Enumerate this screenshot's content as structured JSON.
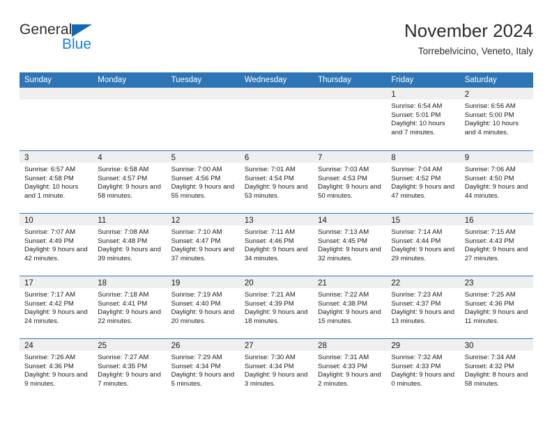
{
  "brand": {
    "word1": "General",
    "word2": "Blue",
    "triangle_color": "#1268b3",
    "blue_color": "#1c7fd1"
  },
  "header": {
    "title": "November 2024",
    "subtitle": "Torrebelvicino, Veneto, Italy"
  },
  "theme": {
    "header_blue": "#2e75b6",
    "day_band_gray": "#efefef",
    "text": "#1a1a1a"
  },
  "weekdays": [
    "Sunday",
    "Monday",
    "Tuesday",
    "Wednesday",
    "Thursday",
    "Friday",
    "Saturday"
  ],
  "weeks": [
    [
      {
        "day": ""
      },
      {
        "day": ""
      },
      {
        "day": ""
      },
      {
        "day": ""
      },
      {
        "day": ""
      },
      {
        "day": "1",
        "sunrise": "Sunrise: 6:54 AM",
        "sunset": "Sunset: 5:01 PM",
        "daylight": "Daylight: 10 hours and 7 minutes."
      },
      {
        "day": "2",
        "sunrise": "Sunrise: 6:56 AM",
        "sunset": "Sunset: 5:00 PM",
        "daylight": "Daylight: 10 hours and 4 minutes."
      }
    ],
    [
      {
        "day": "3",
        "sunrise": "Sunrise: 6:57 AM",
        "sunset": "Sunset: 4:58 PM",
        "daylight": "Daylight: 10 hours and 1 minute."
      },
      {
        "day": "4",
        "sunrise": "Sunrise: 6:58 AM",
        "sunset": "Sunset: 4:57 PM",
        "daylight": "Daylight: 9 hours and 58 minutes."
      },
      {
        "day": "5",
        "sunrise": "Sunrise: 7:00 AM",
        "sunset": "Sunset: 4:56 PM",
        "daylight": "Daylight: 9 hours and 55 minutes."
      },
      {
        "day": "6",
        "sunrise": "Sunrise: 7:01 AM",
        "sunset": "Sunset: 4:54 PM",
        "daylight": "Daylight: 9 hours and 53 minutes."
      },
      {
        "day": "7",
        "sunrise": "Sunrise: 7:03 AM",
        "sunset": "Sunset: 4:53 PM",
        "daylight": "Daylight: 9 hours and 50 minutes."
      },
      {
        "day": "8",
        "sunrise": "Sunrise: 7:04 AM",
        "sunset": "Sunset: 4:52 PM",
        "daylight": "Daylight: 9 hours and 47 minutes."
      },
      {
        "day": "9",
        "sunrise": "Sunrise: 7:06 AM",
        "sunset": "Sunset: 4:50 PM",
        "daylight": "Daylight: 9 hours and 44 minutes."
      }
    ],
    [
      {
        "day": "10",
        "sunrise": "Sunrise: 7:07 AM",
        "sunset": "Sunset: 4:49 PM",
        "daylight": "Daylight: 9 hours and 42 minutes."
      },
      {
        "day": "11",
        "sunrise": "Sunrise: 7:08 AM",
        "sunset": "Sunset: 4:48 PM",
        "daylight": "Daylight: 9 hours and 39 minutes."
      },
      {
        "day": "12",
        "sunrise": "Sunrise: 7:10 AM",
        "sunset": "Sunset: 4:47 PM",
        "daylight": "Daylight: 9 hours and 37 minutes."
      },
      {
        "day": "13",
        "sunrise": "Sunrise: 7:11 AM",
        "sunset": "Sunset: 4:46 PM",
        "daylight": "Daylight: 9 hours and 34 minutes."
      },
      {
        "day": "14",
        "sunrise": "Sunrise: 7:13 AM",
        "sunset": "Sunset: 4:45 PM",
        "daylight": "Daylight: 9 hours and 32 minutes."
      },
      {
        "day": "15",
        "sunrise": "Sunrise: 7:14 AM",
        "sunset": "Sunset: 4:44 PM",
        "daylight": "Daylight: 9 hours and 29 minutes."
      },
      {
        "day": "16",
        "sunrise": "Sunrise: 7:15 AM",
        "sunset": "Sunset: 4:43 PM",
        "daylight": "Daylight: 9 hours and 27 minutes."
      }
    ],
    [
      {
        "day": "17",
        "sunrise": "Sunrise: 7:17 AM",
        "sunset": "Sunset: 4:42 PM",
        "daylight": "Daylight: 9 hours and 24 minutes."
      },
      {
        "day": "18",
        "sunrise": "Sunrise: 7:18 AM",
        "sunset": "Sunset: 4:41 PM",
        "daylight": "Daylight: 9 hours and 22 minutes."
      },
      {
        "day": "19",
        "sunrise": "Sunrise: 7:19 AM",
        "sunset": "Sunset: 4:40 PM",
        "daylight": "Daylight: 9 hours and 20 minutes."
      },
      {
        "day": "20",
        "sunrise": "Sunrise: 7:21 AM",
        "sunset": "Sunset: 4:39 PM",
        "daylight": "Daylight: 9 hours and 18 minutes."
      },
      {
        "day": "21",
        "sunrise": "Sunrise: 7:22 AM",
        "sunset": "Sunset: 4:38 PM",
        "daylight": "Daylight: 9 hours and 15 minutes."
      },
      {
        "day": "22",
        "sunrise": "Sunrise: 7:23 AM",
        "sunset": "Sunset: 4:37 PM",
        "daylight": "Daylight: 9 hours and 13 minutes."
      },
      {
        "day": "23",
        "sunrise": "Sunrise: 7:25 AM",
        "sunset": "Sunset: 4:36 PM",
        "daylight": "Daylight: 9 hours and 11 minutes."
      }
    ],
    [
      {
        "day": "24",
        "sunrise": "Sunrise: 7:26 AM",
        "sunset": "Sunset: 4:36 PM",
        "daylight": "Daylight: 9 hours and 9 minutes."
      },
      {
        "day": "25",
        "sunrise": "Sunrise: 7:27 AM",
        "sunset": "Sunset: 4:35 PM",
        "daylight": "Daylight: 9 hours and 7 minutes."
      },
      {
        "day": "26",
        "sunrise": "Sunrise: 7:29 AM",
        "sunset": "Sunset: 4:34 PM",
        "daylight": "Daylight: 9 hours and 5 minutes."
      },
      {
        "day": "27",
        "sunrise": "Sunrise: 7:30 AM",
        "sunset": "Sunset: 4:34 PM",
        "daylight": "Daylight: 9 hours and 3 minutes."
      },
      {
        "day": "28",
        "sunrise": "Sunrise: 7:31 AM",
        "sunset": "Sunset: 4:33 PM",
        "daylight": "Daylight: 9 hours and 2 minutes."
      },
      {
        "day": "29",
        "sunrise": "Sunrise: 7:32 AM",
        "sunset": "Sunset: 4:33 PM",
        "daylight": "Daylight: 9 hours and 0 minutes."
      },
      {
        "day": "30",
        "sunrise": "Sunrise: 7:34 AM",
        "sunset": "Sunset: 4:32 PM",
        "daylight": "Daylight: 8 hours and 58 minutes."
      }
    ]
  ]
}
